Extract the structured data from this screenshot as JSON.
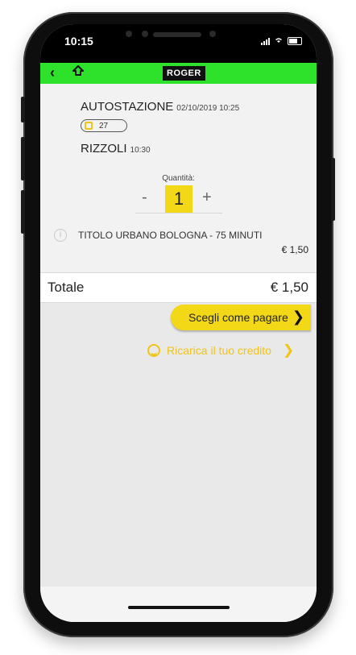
{
  "status": {
    "time": "10:15"
  },
  "header": {
    "back_icon": "back-chevron-icon",
    "home_icon": "home-arrow-icon",
    "logo": "ROGER",
    "accent": "#2ee12a"
  },
  "trip": {
    "from": {
      "name": "AUTOSTAZIONE",
      "datetime": "02/10/2019 10:25"
    },
    "bus_line": "27",
    "to": {
      "name": "RIZZOLI",
      "time": "10:30"
    }
  },
  "quantity": {
    "label": "Quantità:",
    "minus": "-",
    "value": "1",
    "plus": "+"
  },
  "ticket": {
    "title": "TITOLO URBANO BOLOGNA - 75 MINUTI",
    "price": "€ 1,50"
  },
  "total": {
    "label": "Totale",
    "value": "€ 1,50"
  },
  "actions": {
    "pay_label": "Scegli come pagare",
    "recharge_label": "Ricarica il tuo credito",
    "accent": "#f2d816"
  }
}
